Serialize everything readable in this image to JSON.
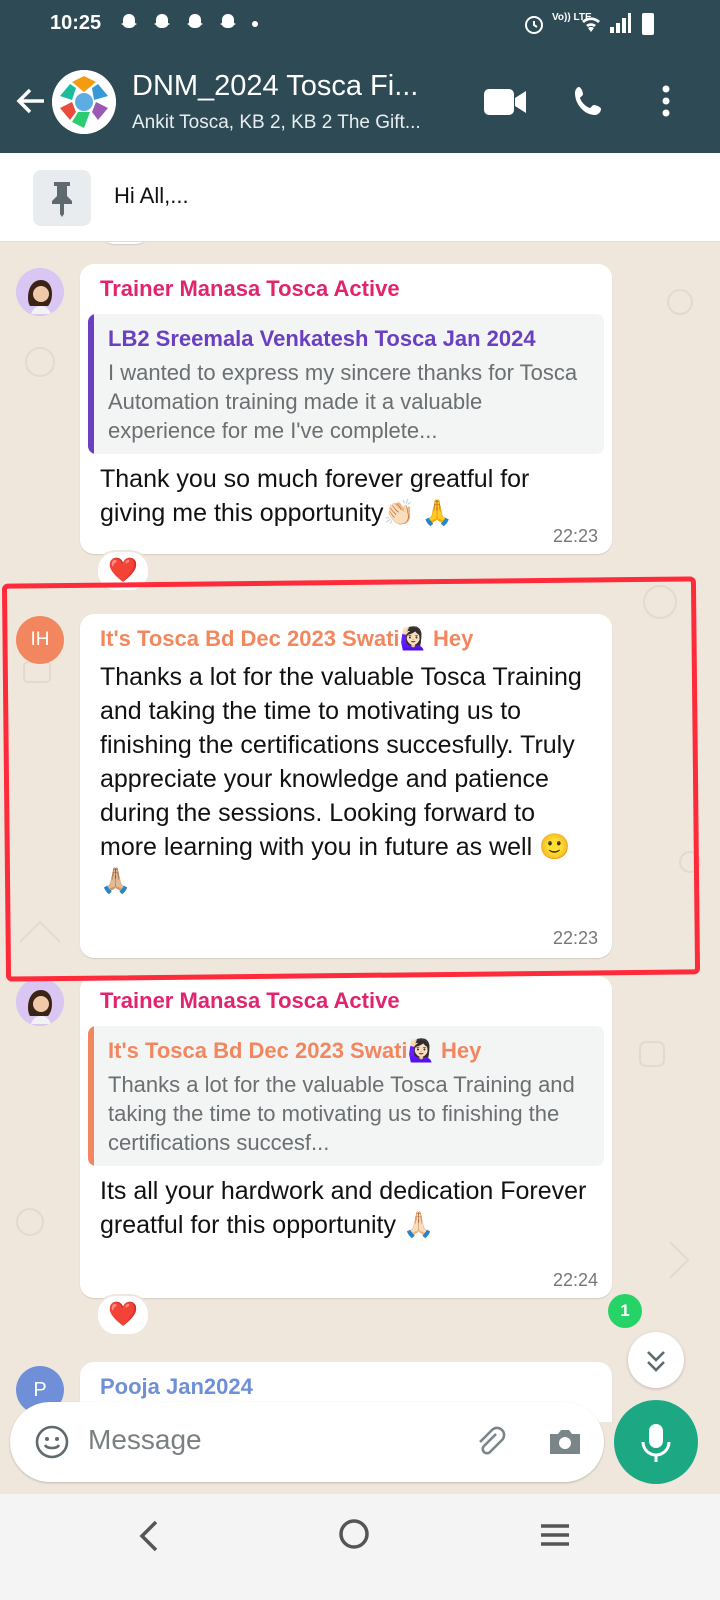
{
  "status_bar": {
    "time": "10:25",
    "notification_icons": [
      "snapchat-icon",
      "snapchat-icon",
      "snapchat-icon",
      "snapchat-icon",
      "dot-icon"
    ],
    "right_icons": [
      "alarm-icon",
      "volte-icon",
      "wifi-icon",
      "signal-icon",
      "battery-icon"
    ],
    "volte_label": "Vo)) LTE"
  },
  "header": {
    "title": "DNM_2024 Tosca Fi...",
    "subtitle": "Ankit Tosca, KB 2, KB 2 The Gift..."
  },
  "pinned": {
    "text": "Hi All,..."
  },
  "messages": [
    {
      "sender": "Trainer Manasa Tosca Active",
      "sender_color": "#e0246f",
      "quote": {
        "name": "LB2 Sreemala Venkatesh Tosca Jan 2024",
        "name_color": "#6a3fc1",
        "text": "I wanted to express my sincere thanks for Tosca Automation training made it a valuable experience for me I've complete..."
      },
      "text": "Thank you so much forever greatful for giving me this opportunity👏🏻 🙏",
      "time": "22:23",
      "reaction": "❤️"
    },
    {
      "sender": "It's Tosca Bd Dec 2023 Swati🙋🏻‍♀️ Hey",
      "sender_color": "#f2875f",
      "avatar_initials": "IH",
      "text": "Thanks a lot for the valuable Tosca Training and taking the time to motivating us to finishing the certifications succesfully. Truly appreciate your knowledge and patience during the sessions. Looking forward to more learning with you in future as well 🙂 🙏🏼",
      "time": "22:23"
    },
    {
      "sender": "Trainer Manasa Tosca Active",
      "sender_color": "#e0246f",
      "quote": {
        "name": "It's Tosca Bd Dec 2023 Swati🙋🏻‍♀️ Hey",
        "name_color": "#f2875f",
        "text": "Thanks a lot for the valuable Tosca Training and taking the time to motivating us to finishing the certifications succesf..."
      },
      "text": "Its all your hardwork and dedication Forever greatful for this opportunity 🙏🏻",
      "time": "22:24",
      "reaction": "❤️"
    },
    {
      "sender": "Pooja Jan2024",
      "sender_color": "#6f8fd8",
      "avatar_initials": "P"
    }
  ],
  "unread_badge": "1",
  "composer": {
    "placeholder": "Message"
  },
  "colors": {
    "header": "#2e4a54",
    "accent": "#1da884",
    "chat_bg": "#efe7dc",
    "annotation": "#ff2a3a"
  }
}
